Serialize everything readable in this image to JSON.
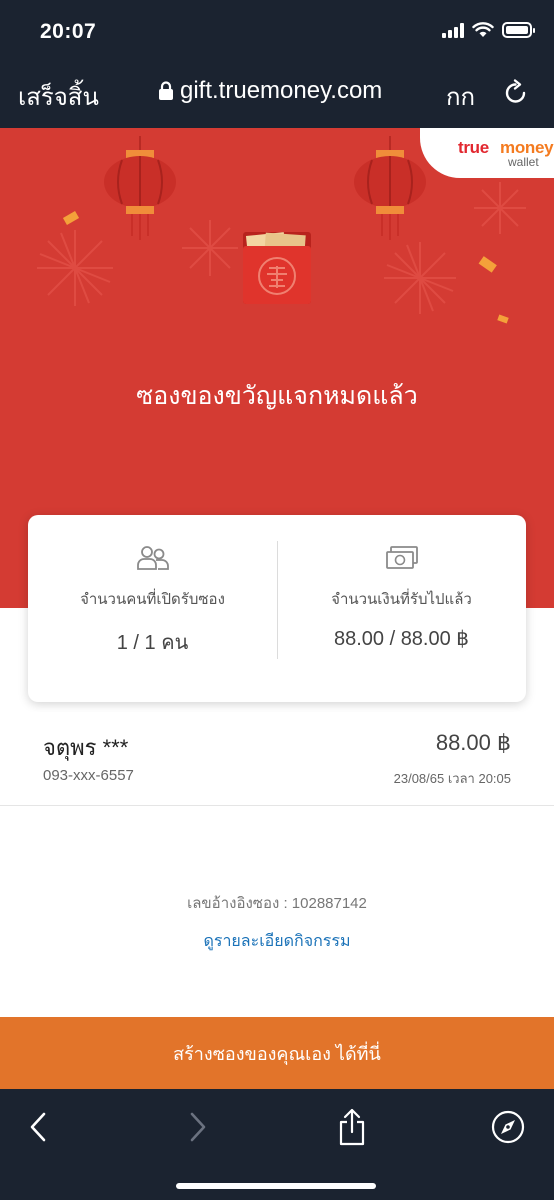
{
  "status_bar": {
    "time": "20:07",
    "icons": [
      "signal-icon",
      "wifi-icon",
      "battery-icon"
    ]
  },
  "browser": {
    "done_label": "เสร็จสิ้น",
    "url": "gift.truemoney.com",
    "text_size_label": "กก",
    "icons": [
      "lock-icon",
      "reload-icon"
    ]
  },
  "brand": {
    "name_part1": "true",
    "name_part2": "money",
    "sub": "wallet",
    "colors": {
      "red": "#e2272f",
      "orange": "#f47b20"
    }
  },
  "hero": {
    "title": "ซองของขวัญแจกหมดแล้ว",
    "background": "#d43b33",
    "icons": [
      "lantern-icon",
      "red-envelope-icon",
      "firework-icon"
    ]
  },
  "stats": {
    "people": {
      "label": "จำนวนคนที่เปิดรับซอง",
      "value": "1 / 1 คน",
      "icon": "people-icon"
    },
    "money": {
      "label": "จำนวนเงินที่รับไปแล้ว",
      "value": "88.00 / 88.00 ฿",
      "icon": "banknote-icon"
    }
  },
  "receivers": [
    {
      "name": "จตุพร ***",
      "phone": "093-xxx-6557",
      "amount": "88.00 ฿",
      "datetime": "23/08/65 เวลา 20:05"
    }
  ],
  "reference": "เลขอ้างอิงซอง : 102887142",
  "detail_link": "ดูรายละเอียดกิจกรรม",
  "cta_label": "สร้างซองของคุณเอง ได้ที่นี่",
  "cta_color": "#e2742a",
  "toolbar": {
    "icons": [
      "back-icon",
      "forward-icon",
      "share-icon",
      "compass-icon"
    ]
  }
}
